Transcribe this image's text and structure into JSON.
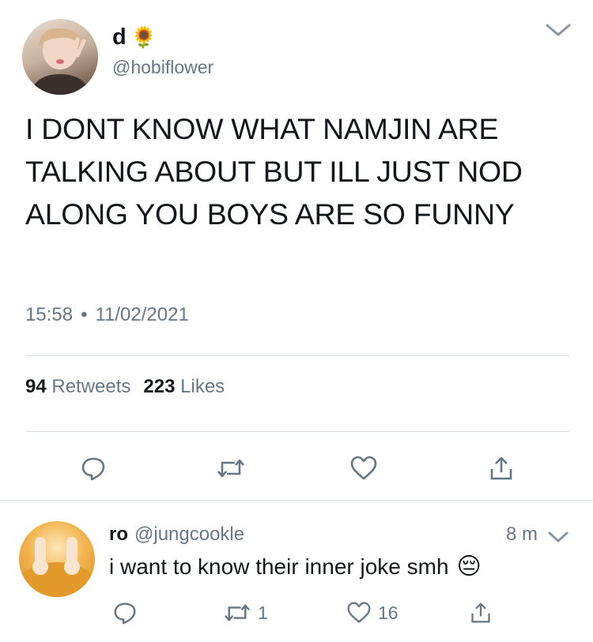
{
  "tweet": {
    "display_name": "d",
    "name_emoji": "🌻",
    "handle": "@hobiflower",
    "text": "I DONT KNOW WHAT NAMJIN ARE TALKING ABOUT BUT ILL JUST NOD ALONG YOU BOYS ARE SO FUNNY",
    "time": "15:58",
    "separator": "•",
    "date": "11/02/2021",
    "retweets_count": "94",
    "retweets_label": "Retweets",
    "likes_count": "223",
    "likes_label": "Likes"
  },
  "reply": {
    "display_name": "ro",
    "handle": "@jungcookle",
    "time": "8 m",
    "text": "i want to know their inner joke smh",
    "emoji": "😔",
    "retweet_count": "1",
    "like_count": "16"
  },
  "icons": {
    "caret": "chevron-down-icon",
    "reply": "reply-bubble-icon",
    "retweet": "retweet-icon",
    "like": "heart-icon",
    "share": "share-icon"
  },
  "colors": {
    "text": "#14171a",
    "secondary": "#657786",
    "divider": "#d8dde1",
    "icon": "#657786"
  }
}
